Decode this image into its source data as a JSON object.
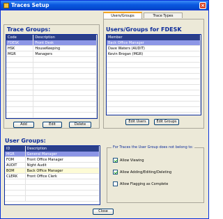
{
  "window": {
    "title": "Traces Setup",
    "close_glyph": "×"
  },
  "trace_groups": {
    "heading": "Trace Groups:",
    "columns": [
      "Code",
      "Description"
    ],
    "rows": [
      {
        "code": "FDESK",
        "desc": "Front Desk"
      },
      {
        "code": "HSK",
        "desc": "HouseKeeping"
      },
      {
        "code": "MGR",
        "desc": "Managers"
      }
    ],
    "selected_index": 0,
    "buttons": {
      "add": "Add",
      "edit": "Edit",
      "delete": "Delete"
    }
  },
  "tabs": {
    "active": "Users/Groups",
    "inactive": "Trace Types"
  },
  "users_groups": {
    "heading": "Users/Groups for FDESK",
    "columns": [
      "Member"
    ],
    "rows": [
      "Back Office Manager",
      "Dave Waters (AUDIT)",
      "Kevin Brogan (MGR)"
    ],
    "selected_index": 0,
    "buttons": {
      "edit_users": "Edit Users",
      "edit_groups": "Edit Groups"
    }
  },
  "user_groups": {
    "heading": "User Groups:",
    "columns": [
      "ID",
      "Description"
    ],
    "rows": [
      {
        "id": "MGR",
        "desc": "General Manager"
      },
      {
        "id": "FOM",
        "desc": "Front Office Manager"
      },
      {
        "id": "AUDIT",
        "desc": "Night Audit"
      },
      {
        "id": "BOM",
        "desc": "Back Office Manager"
      },
      {
        "id": "CLERK",
        "desc": "Front Office Clerk"
      }
    ],
    "selected_index": 0
  },
  "permissions": {
    "title": "For Traces the User Group does not belong to:",
    "options": [
      {
        "label": "Allow Viewing",
        "checked": true
      },
      {
        "label": "Allow Adding/Editing/Deleting",
        "checked": true
      },
      {
        "label": "Allow Flagging as Complete",
        "checked": false
      }
    ]
  },
  "close_button": "Close",
  "colors": {
    "accent": "#0a2a9a",
    "selected_row": "#8c96e6",
    "title_bar": "#0a58e0"
  }
}
